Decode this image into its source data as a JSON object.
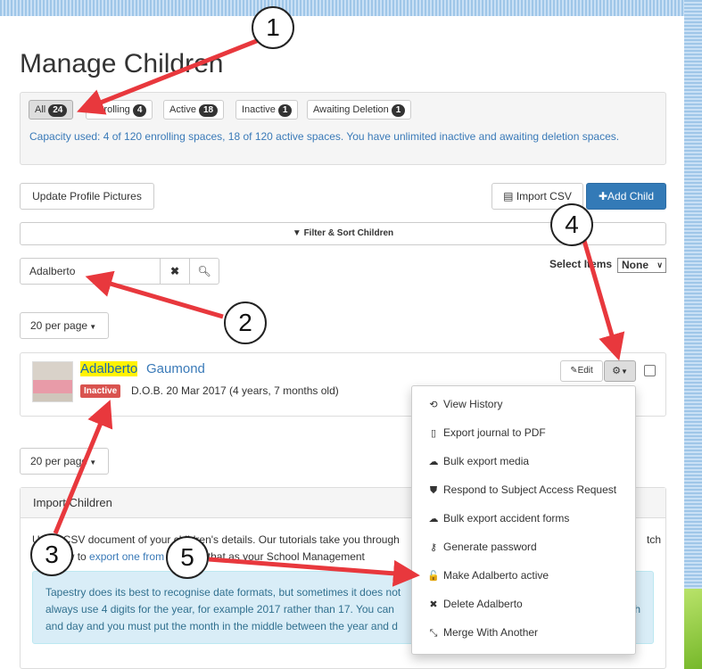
{
  "page_title": "Manage Children",
  "tabs": [
    {
      "label": "All",
      "count": "24",
      "active": true
    },
    {
      "label": "Enrolling",
      "count": "4"
    },
    {
      "label": "Active",
      "count": "18"
    },
    {
      "label": "Inactive",
      "count": "1"
    },
    {
      "label": "Awaiting Deletion",
      "count": "1"
    }
  ],
  "capacity_text": "Capacity used: 4 of 120 enrolling spaces, 18 of 120 active spaces. You have unlimited inactive and awaiting deletion spaces.",
  "toolbar": {
    "update_pictures": "Update Profile Pictures",
    "import_csv": "Import CSV",
    "add_child": "Add Child"
  },
  "filter_label": "Filter & Sort Children",
  "search": {
    "value": "Adalberto"
  },
  "select_items": {
    "label": "Select Items",
    "value": "None"
  },
  "per_page_top": "20 per page",
  "per_page_bottom": "20 per page",
  "child": {
    "first_name": "Adalberto",
    "last_name": "Gaumond",
    "status": "Inactive",
    "dob": "D.O.B. 20 Mar 2017 (4 years, 7 months old)",
    "edit_label": "Edit"
  },
  "dropdown_menu": [
    {
      "label": "View History",
      "icon": "history-icon",
      "glyph": "⟲"
    },
    {
      "label": "Export journal to PDF",
      "icon": "pdf-icon",
      "glyph": "▯"
    },
    {
      "label": "Bulk export media",
      "icon": "cloud-download-icon",
      "glyph": "☁"
    },
    {
      "label": "Respond to Subject Access Request",
      "icon": "shield-icon",
      "glyph": "⛊"
    },
    {
      "label": "Bulk export accident forms",
      "icon": "cloud-download-icon",
      "glyph": "☁"
    },
    {
      "label": "Generate password",
      "icon": "key-icon",
      "glyph": "⚷"
    },
    {
      "label": "Make Adalberto active",
      "icon": "unlock-icon",
      "glyph": "🔓"
    },
    {
      "label": "Delete Adalberto",
      "icon": "close-icon",
      "glyph": "✖"
    },
    {
      "label": "Merge With Another",
      "icon": "merge-icon",
      "glyph": "⤡"
    }
  ],
  "import_panel": {
    "heading": "Import Children",
    "line1_a": "Use a CSV document of your children's details. Our tutorials take you through",
    "line1_b": "tch",
    "line2_a": "this, how to ",
    "line2_link": "export one from",
    "line2_b": " you use that as your School Management",
    "info_line1": "Tapestry does its best to recognise date formats, but sometimes it does not",
    "info_line1_end": "",
    "info_line2": "always use 4 digits for the year, for example 2017 rather than 17. You can",
    "info_line2_end": "h",
    "info_line3": "and day and you must put the month in the middle between the year and d"
  },
  "callouts": [
    "1",
    "2",
    "3",
    "4",
    "5"
  ],
  "colors": {
    "primary": "#337ab7",
    "danger": "#d9534f",
    "highlight": "#fff200",
    "arrow": "#e8383d"
  }
}
